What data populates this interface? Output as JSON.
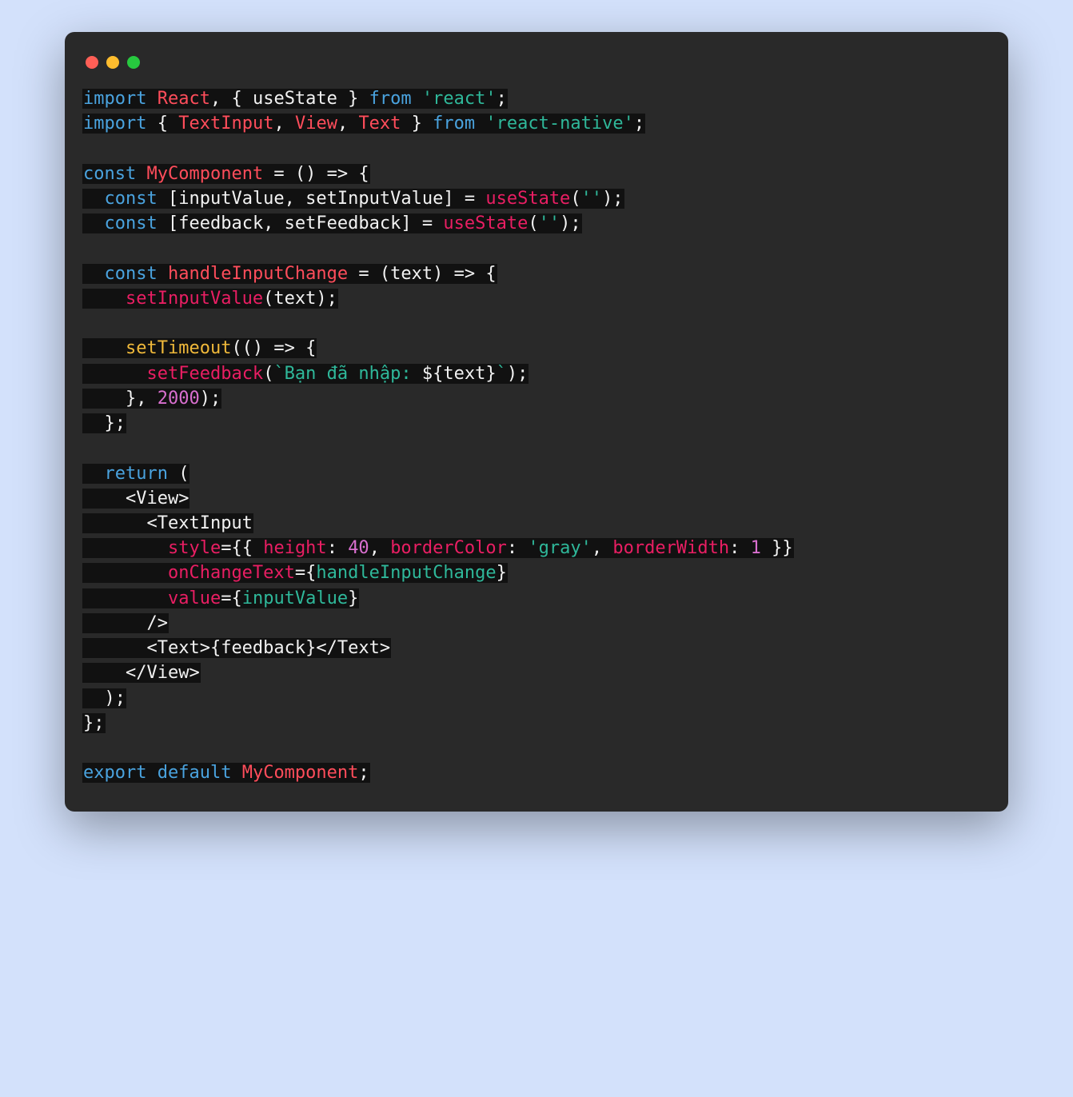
{
  "window": {
    "buttons": [
      "close",
      "minimize",
      "maximize"
    ]
  },
  "code": {
    "lines": [
      [
        {
          "t": "import",
          "c": "c-kw"
        },
        {
          "t": " ",
          "c": "c-def"
        },
        {
          "t": "React",
          "c": "c-red"
        },
        {
          "t": ", { ",
          "c": "c-def"
        },
        {
          "t": "useState",
          "c": "c-def"
        },
        {
          "t": " } ",
          "c": "c-def"
        },
        {
          "t": "from",
          "c": "c-kw"
        },
        {
          "t": " ",
          "c": "c-def"
        },
        {
          "t": "'react'",
          "c": "c-str"
        },
        {
          "t": ";",
          "c": "c-def"
        }
      ],
      [
        {
          "t": "import",
          "c": "c-kw"
        },
        {
          "t": " { ",
          "c": "c-def"
        },
        {
          "t": "TextInput",
          "c": "c-red"
        },
        {
          "t": ", ",
          "c": "c-def"
        },
        {
          "t": "View",
          "c": "c-red"
        },
        {
          "t": ", ",
          "c": "c-def"
        },
        {
          "t": "Text",
          "c": "c-red"
        },
        {
          "t": " } ",
          "c": "c-def"
        },
        {
          "t": "from",
          "c": "c-kw"
        },
        {
          "t": " ",
          "c": "c-def"
        },
        {
          "t": "'react-native'",
          "c": "c-str"
        },
        {
          "t": ";",
          "c": "c-def"
        }
      ],
      [],
      [
        {
          "t": "const",
          "c": "c-kw"
        },
        {
          "t": " ",
          "c": "c-def"
        },
        {
          "t": "MyComponent",
          "c": "c-red"
        },
        {
          "t": " = () => {",
          "c": "c-def"
        }
      ],
      [
        {
          "t": "  ",
          "c": "c-def"
        },
        {
          "t": "const",
          "c": "c-kw"
        },
        {
          "t": " [inputValue, setInputValue] = ",
          "c": "c-def"
        },
        {
          "t": "useState",
          "c": "c-call"
        },
        {
          "t": "(",
          "c": "c-def"
        },
        {
          "t": "''",
          "c": "c-str"
        },
        {
          "t": ");",
          "c": "c-def"
        }
      ],
      [
        {
          "t": "  ",
          "c": "c-def"
        },
        {
          "t": "const",
          "c": "c-kw"
        },
        {
          "t": " [feedback, setFeedback] = ",
          "c": "c-def"
        },
        {
          "t": "useState",
          "c": "c-call"
        },
        {
          "t": "(",
          "c": "c-def"
        },
        {
          "t": "''",
          "c": "c-str"
        },
        {
          "t": ");",
          "c": "c-def"
        }
      ],
      [],
      [
        {
          "t": "  ",
          "c": "c-def"
        },
        {
          "t": "const",
          "c": "c-kw"
        },
        {
          "t": " ",
          "c": "c-def"
        },
        {
          "t": "handleInputChange",
          "c": "c-red"
        },
        {
          "t": " = (text) => {",
          "c": "c-def"
        }
      ],
      [
        {
          "t": "    ",
          "c": "c-def"
        },
        {
          "t": "setInputValue",
          "c": "c-call"
        },
        {
          "t": "(text);",
          "c": "c-def"
        }
      ],
      [],
      [
        {
          "t": "    ",
          "c": "c-def"
        },
        {
          "t": "setTimeout",
          "c": "c-fn"
        },
        {
          "t": "(() => {",
          "c": "c-def"
        }
      ],
      [
        {
          "t": "      ",
          "c": "c-def"
        },
        {
          "t": "setFeedback",
          "c": "c-call"
        },
        {
          "t": "(",
          "c": "c-def"
        },
        {
          "t": "`Bạn đã nhập: ",
          "c": "c-str"
        },
        {
          "t": "${",
          "c": "c-def"
        },
        {
          "t": "text",
          "c": "c-def"
        },
        {
          "t": "}",
          "c": "c-def"
        },
        {
          "t": "`",
          "c": "c-str"
        },
        {
          "t": ");",
          "c": "c-def"
        }
      ],
      [
        {
          "t": "    }, ",
          "c": "c-def"
        },
        {
          "t": "2000",
          "c": "c-num"
        },
        {
          "t": ");",
          "c": "c-def"
        }
      ],
      [
        {
          "t": "  };",
          "c": "c-def"
        }
      ],
      [],
      [
        {
          "t": "  ",
          "c": "c-def"
        },
        {
          "t": "return",
          "c": "c-kw"
        },
        {
          "t": " (",
          "c": "c-def"
        }
      ],
      [
        {
          "t": "    <",
          "c": "c-def"
        },
        {
          "t": "View",
          "c": "c-def"
        },
        {
          "t": ">",
          "c": "c-def"
        }
      ],
      [
        {
          "t": "      <",
          "c": "c-def"
        },
        {
          "t": "TextInput",
          "c": "c-def"
        }
      ],
      [
        {
          "t": "        ",
          "c": "c-def"
        },
        {
          "t": "style",
          "c": "c-prop"
        },
        {
          "t": "=",
          "c": "c-def"
        },
        {
          "t": "{{ ",
          "c": "c-def"
        },
        {
          "t": "height",
          "c": "c-litkw"
        },
        {
          "t": ": ",
          "c": "c-def"
        },
        {
          "t": "40",
          "c": "c-num"
        },
        {
          "t": ", ",
          "c": "c-def"
        },
        {
          "t": "borderColor",
          "c": "c-litkw"
        },
        {
          "t": ": ",
          "c": "c-def"
        },
        {
          "t": "'gray'",
          "c": "c-str"
        },
        {
          "t": ", ",
          "c": "c-def"
        },
        {
          "t": "borderWidth",
          "c": "c-litkw"
        },
        {
          "t": ": ",
          "c": "c-def"
        },
        {
          "t": "1",
          "c": "c-num"
        },
        {
          "t": " }}",
          "c": "c-def"
        }
      ],
      [
        {
          "t": "        ",
          "c": "c-def"
        },
        {
          "t": "onChangeText",
          "c": "c-prop"
        },
        {
          "t": "=",
          "c": "c-def"
        },
        {
          "t": "{",
          "c": "c-def"
        },
        {
          "t": "handleInputChange",
          "c": "c-var"
        },
        {
          "t": "}",
          "c": "c-def"
        }
      ],
      [
        {
          "t": "        ",
          "c": "c-def"
        },
        {
          "t": "value",
          "c": "c-prop"
        },
        {
          "t": "=",
          "c": "c-def"
        },
        {
          "t": "{",
          "c": "c-def"
        },
        {
          "t": "inputValue",
          "c": "c-var"
        },
        {
          "t": "}",
          "c": "c-def"
        }
      ],
      [
        {
          "t": "      />",
          "c": "c-def"
        }
      ],
      [
        {
          "t": "      <",
          "c": "c-def"
        },
        {
          "t": "Text",
          "c": "c-def"
        },
        {
          "t": ">{feedback}</",
          "c": "c-def"
        },
        {
          "t": "Text",
          "c": "c-def"
        },
        {
          "t": ">",
          "c": "c-def"
        }
      ],
      [
        {
          "t": "    </",
          "c": "c-def"
        },
        {
          "t": "View",
          "c": "c-def"
        },
        {
          "t": ">",
          "c": "c-def"
        }
      ],
      [
        {
          "t": "  );",
          "c": "c-def"
        }
      ],
      [
        {
          "t": "};",
          "c": "c-def"
        }
      ],
      [],
      [
        {
          "t": "export",
          "c": "c-kw"
        },
        {
          "t": " ",
          "c": "c-def"
        },
        {
          "t": "default",
          "c": "c-kw"
        },
        {
          "t": " ",
          "c": "c-def"
        },
        {
          "t": "MyComponent",
          "c": "c-red"
        },
        {
          "t": ";",
          "c": "c-def"
        }
      ]
    ]
  }
}
